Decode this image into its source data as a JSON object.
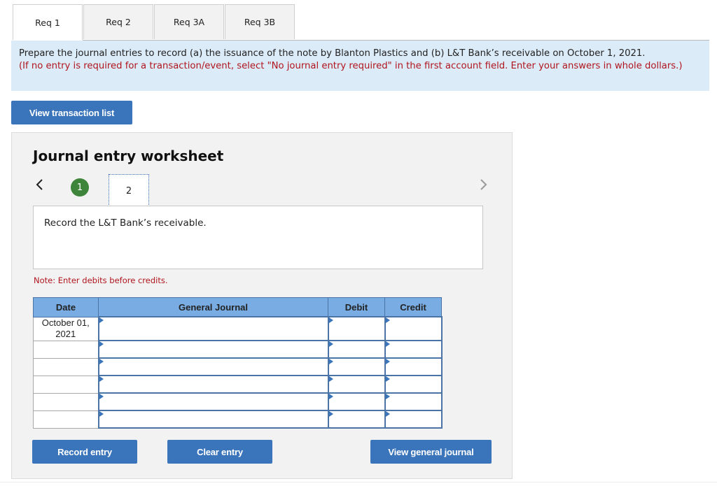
{
  "tabs": [
    {
      "label": "Req 1",
      "active": true
    },
    {
      "label": "Req 2",
      "active": false
    },
    {
      "label": "Req 3A",
      "active": false
    },
    {
      "label": "Req 3B",
      "active": false
    }
  ],
  "instructions": {
    "main": "Prepare the journal entries to record (a) the issuance of the note by Blanton Plastics and (b) L&T Bank’s receivable on October 1, 2021.",
    "note": "(If no entry is required for a transaction/event, select \"No journal entry required\" in the first account field. Enter your answers in whole dollars.)"
  },
  "view_transaction_list_label": "View transaction list",
  "worksheet": {
    "title": "Journal entry worksheet",
    "nav_prev_icon": "chevron-left-icon",
    "nav_next_icon": "chevron-right-icon",
    "steps": [
      {
        "number": "1",
        "status": "completed"
      },
      {
        "number": "2",
        "status": "current"
      }
    ],
    "description": "Record the L&T Bank’s receivable.",
    "note": "Note: Enter debits before credits.",
    "table": {
      "columns": [
        "Date",
        "General Journal",
        "Debit",
        "Credit"
      ],
      "rows": [
        {
          "date": "October 01, 2021",
          "account": "",
          "debit": "",
          "credit": ""
        },
        {
          "date": "",
          "account": "",
          "debit": "",
          "credit": ""
        },
        {
          "date": "",
          "account": "",
          "debit": "",
          "credit": ""
        },
        {
          "date": "",
          "account": "",
          "debit": "",
          "credit": ""
        },
        {
          "date": "",
          "account": "",
          "debit": "",
          "credit": ""
        },
        {
          "date": "",
          "account": "",
          "debit": "",
          "credit": ""
        }
      ]
    },
    "buttons": {
      "record": "Record entry",
      "clear": "Clear entry",
      "view_general_journal": "View general journal"
    }
  },
  "colors": {
    "button_blue": "#3a75bb",
    "banner_bg": "#dcebf8",
    "alert_red": "#b0151e",
    "step_complete_green": "#3f843b",
    "table_header_blue": "#78ace2"
  }
}
